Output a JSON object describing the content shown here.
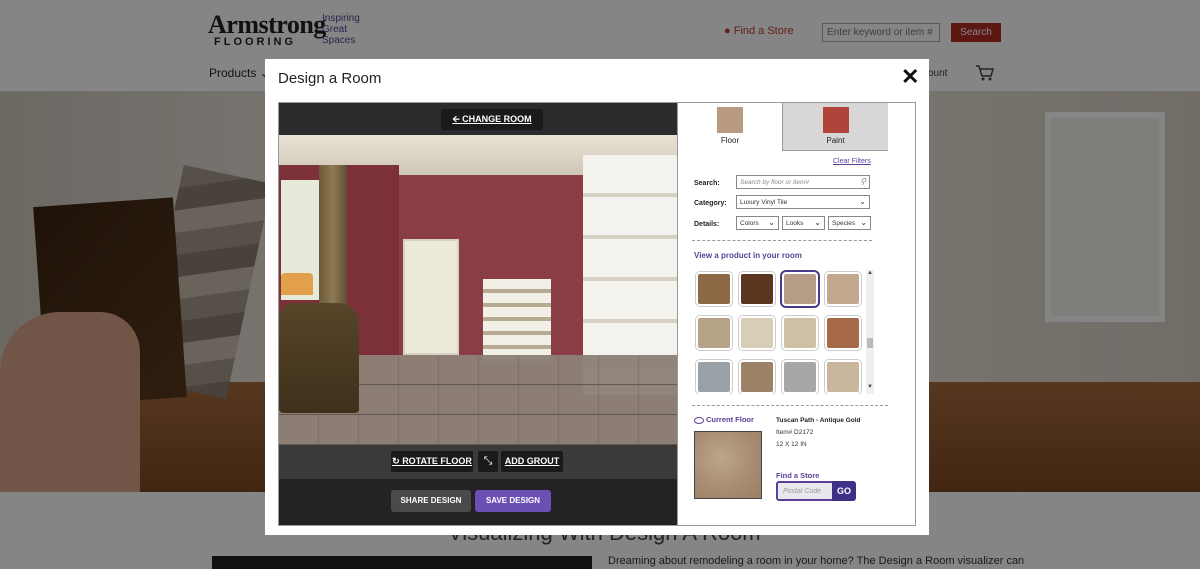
{
  "site": {
    "logo_main": "Armstrong",
    "logo_sub": "FLOORING",
    "logo_tagline": "Inspiring Great Spaces",
    "find_store": "Find a Store",
    "search_placeholder": "Enter keyword or item #",
    "search_button": "Search",
    "nav_products": "Products",
    "nav_account": "ount",
    "under_title": "Visualizing With Design A Room",
    "under_text": "Dreaming about remodeling a room in your home? The Design a Room visualizer can"
  },
  "modal": {
    "title": "Design a Room",
    "close": "✕"
  },
  "viewer": {
    "change_room": "CHANGE ROOM",
    "rotate_floor": "ROTATE FLOOR",
    "add_grout": "ADD GROUT",
    "share_design": "SHARE DESIGN",
    "save_design": "SAVE DESIGN"
  },
  "panel": {
    "tabs": [
      {
        "label": "Floor",
        "color": "#b89a80",
        "active": true
      },
      {
        "label": "Paint",
        "color": "#b1443a",
        "active": false
      }
    ],
    "clear_filters": "Clear Filters",
    "search_label": "Search:",
    "search_placeholder": "Search by floor or item#",
    "category_label": "Category:",
    "category_value": "Luxury Vinyl Tile",
    "details_label": "Details:",
    "details": [
      "Colors",
      "Looks",
      "Species"
    ],
    "view_product": "View a product in your room",
    "swatches": [
      {
        "color": "#8c6a44",
        "selected": false
      },
      {
        "color": "#5a3621",
        "selected": false
      },
      {
        "color": "#b59c85",
        "selected": true
      },
      {
        "color": "#c2a88e",
        "selected": false
      },
      {
        "color": "#b7a488",
        "selected": false
      },
      {
        "color": "#d8cdb7",
        "selected": false
      },
      {
        "color": "#cfc0a5",
        "selected": false
      },
      {
        "color": "#a6694a",
        "selected": false
      },
      {
        "color": "#9aa1a6",
        "selected": false
      },
      {
        "color": "#9c8367",
        "selected": false
      },
      {
        "color": "#a7a6a8",
        "selected": false
      },
      {
        "color": "#c8b69d",
        "selected": false
      }
    ],
    "current_floor_label": "Current Floor",
    "product_name": "Tuscan Path - Antique Gold",
    "product_item": "Item# D2172",
    "product_size": "12 X 12 IN",
    "find_store_label": "Find a Store",
    "postal_placeholder": "Postal Code",
    "go_button": "GO"
  }
}
